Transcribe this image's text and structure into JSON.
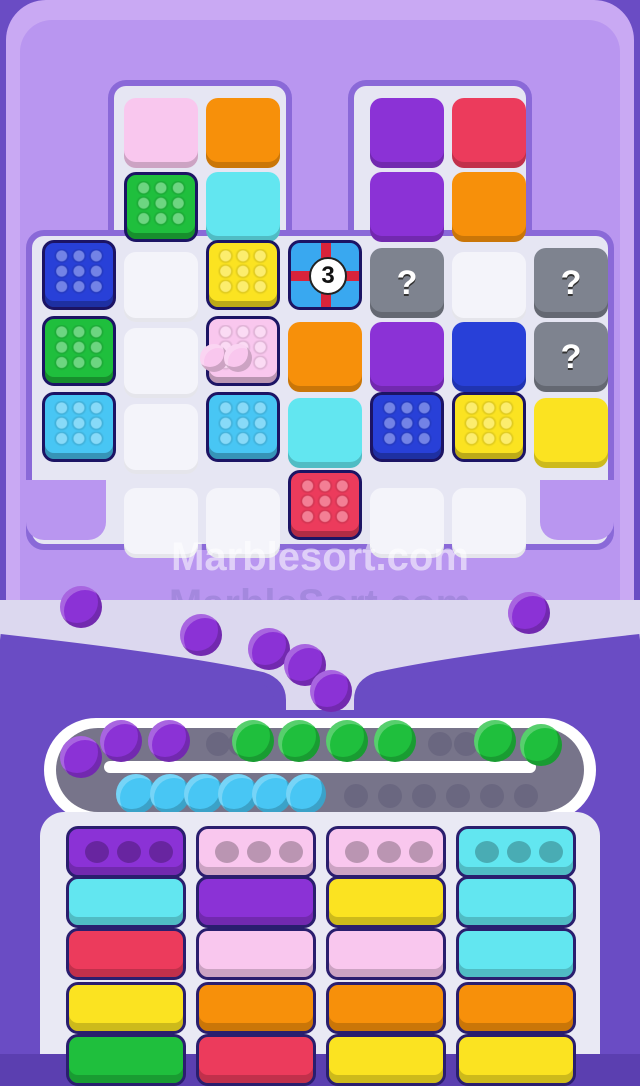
{
  "watermarks": [
    "Marblesort.com",
    "MarbleSort.com"
  ],
  "colors": {
    "pink": "#f9c7ee",
    "orange": "#f7900a",
    "purple": "#8b32d6",
    "red": "#ec3b5c",
    "green": "#1fbf3d",
    "cyan": "#62e6f0",
    "blue": "#2840d8",
    "yellow": "#fbe321",
    "lightblue": "#48c6f4",
    "gray": "#7e838f",
    "white": "#f4f4fa"
  },
  "board": {
    "tiles": [
      {
        "c": "pink",
        "t": "flat"
      },
      {
        "c": "orange",
        "t": "flat"
      },
      {
        "c": "purple",
        "t": "flat"
      },
      {
        "c": "red",
        "t": "flat"
      },
      {
        "c": "green",
        "t": "crate"
      },
      {
        "c": "cyan",
        "t": "flat"
      },
      {
        "c": "purple",
        "t": "flat"
      },
      {
        "c": "orange",
        "t": "flat"
      },
      {
        "c": "blue",
        "t": "crate"
      },
      {
        "c": "white",
        "t": "empty"
      },
      {
        "c": "yellow",
        "t": "crate"
      },
      {
        "c": "gift",
        "t": "gift",
        "label": "3"
      },
      {
        "c": "gray",
        "t": "mystery",
        "label": "?"
      },
      {
        "c": "white",
        "t": "empty"
      },
      {
        "c": "gray",
        "t": "mystery",
        "label": "?"
      },
      {
        "c": "green",
        "t": "crate"
      },
      {
        "c": "white",
        "t": "empty"
      },
      {
        "c": "pink",
        "t": "crate"
      },
      {
        "c": "orange",
        "t": "flat"
      },
      {
        "c": "purple",
        "t": "flat"
      },
      {
        "c": "blue",
        "t": "flat"
      },
      {
        "c": "gray",
        "t": "mystery",
        "label": "?"
      },
      {
        "c": "lightblue",
        "t": "crate"
      },
      {
        "c": "white",
        "t": "empty"
      },
      {
        "c": "lightblue",
        "t": "crate"
      },
      {
        "c": "cyan",
        "t": "flat"
      },
      {
        "c": "blue",
        "t": "crate"
      },
      {
        "c": "yellow",
        "t": "crate"
      },
      {
        "c": "yellow",
        "t": "flat"
      },
      {
        "c": "white",
        "t": "empty"
      },
      {
        "c": "white",
        "t": "empty"
      },
      {
        "c": "red",
        "t": "crate"
      },
      {
        "c": "white",
        "t": "empty"
      },
      {
        "c": "white",
        "t": "empty"
      }
    ]
  },
  "falling_marbles": [
    "purple",
    "purple",
    "purple",
    "purple",
    "purple",
    "purple"
  ],
  "conveyor": {
    "top_row": [
      "purple",
      "purple",
      "purple",
      "empty",
      "empty",
      "green",
      "green",
      "green",
      "green",
      "empty",
      "empty",
      "green",
      "green"
    ],
    "bottom_row": [
      "lightblue",
      "lightblue",
      "lightblue",
      "lightblue",
      "lightblue",
      "lightblue",
      "empty",
      "empty",
      "empty",
      "empty",
      "empty",
      "empty"
    ]
  },
  "bins": [
    [
      "purple",
      "cyan",
      "red",
      "yellow",
      "green"
    ],
    [
      "pink",
      "purple",
      "pink",
      "orange",
      "red"
    ],
    [
      "pink",
      "yellow",
      "pink",
      "orange",
      "yellow"
    ],
    [
      "cyan",
      "cyan",
      "cyan",
      "orange",
      "yellow"
    ]
  ]
}
